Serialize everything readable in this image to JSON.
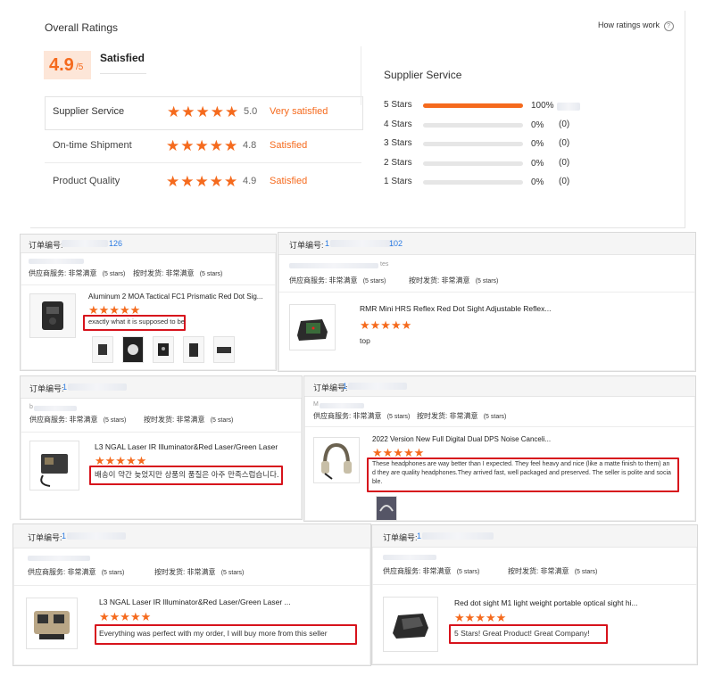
{
  "overall": {
    "title": "Overall Ratings",
    "help_link": "How ratings work",
    "score": "4.9",
    "score_suffix": "/5",
    "level": "Satisfied",
    "stars": "★★★★★",
    "rows": [
      {
        "label": "Supplier Service",
        "score": "5.0",
        "desc": "Very satisfied"
      },
      {
        "label": "On-time Shipment",
        "score": "4.8",
        "desc": "Satisfied"
      },
      {
        "label": "Product Quality",
        "score": "4.9",
        "desc": "Satisfied"
      }
    ]
  },
  "supplier_service": {
    "title": "Supplier Service",
    "bars": [
      {
        "label": "5 Stars",
        "percent": "100%",
        "count": "",
        "fill": 1.0
      },
      {
        "label": "4 Stars",
        "percent": "0%",
        "count": "(0)",
        "fill": 0
      },
      {
        "label": "3 Stars",
        "percent": "0%",
        "count": "(0)",
        "fill": 0
      },
      {
        "label": "2 Stars",
        "percent": "0%",
        "count": "(0)",
        "fill": 0
      },
      {
        "label": "1 Stars",
        "percent": "0%",
        "count": "(0)",
        "fill": 0
      }
    ]
  },
  "reviews": [
    {
      "order_label": "订单编号:",
      "order_suffix": "126",
      "supplier_label": "供应商服务:",
      "supplier_value": "非常满意",
      "supplier_stars": "(5 stars)",
      "ship_label": "按时发货:",
      "ship_value": "非常满意",
      "ship_stars": "(5 stars)",
      "product": "Aluminum 2 MOA Tactical FC1 Prismatic Red Dot Sig...",
      "stars": "★★★★★",
      "comment": "exactly what it is supposed to be"
    },
    {
      "order_label": "订单编号:",
      "order_prefix": "1",
      "order_suffix": "102",
      "owner_suffix": "tes",
      "supplier_label": "供应商服务:",
      "supplier_value": "非常满意",
      "supplier_stars": "(5 stars)",
      "ship_label": "按时发货:",
      "ship_value": "非常满意",
      "ship_stars": "(5 stars)",
      "product": "RMR Mini HRS Reflex Red Dot Sight Adjustable Reflex...",
      "stars": "★★★★★",
      "comment": "top"
    },
    {
      "order_label": "订单编号:",
      "order_prefix": "1",
      "owner_prefix": "b",
      "supplier_label": "供应商服务:",
      "supplier_value": "非常满意",
      "supplier_stars": "(5 stars)",
      "ship_label": "按时发货:",
      "ship_value": "非常满意",
      "ship_stars": "(5 stars)",
      "product": "L3 NGAL Laser IR Illuminator&Red Laser/Green Laser",
      "stars": "★★★★★",
      "comment": "배송이 약간 늦었지만 상품의 품질은 아주 만족스럽습니다."
    },
    {
      "order_label": "订单编号:",
      "order_prefix": "1",
      "owner_prefix": "M",
      "supplier_label": "供应商服务:",
      "supplier_value": "非常满意",
      "supplier_stars": "(5 stars)",
      "ship_label": "按时发货:",
      "ship_value": "非常满意",
      "ship_stars": "(5 stars)",
      "product": "2022 Version New Full Digital Dual DPS Noise Canceli...",
      "stars": "★★★★★",
      "comment_line1": "These headphones are way better than I expected. They feel heavy and nice (like a matte finish to them) an",
      "comment_line2": "d they are quality headphones.They arrived fast, well packaged and preserved. The seller is polite and socia",
      "comment_line3": "ble."
    },
    {
      "order_label": "订单编号:",
      "order_prefix": "1",
      "supplier_label": "供应商服务:",
      "supplier_value": "非常满意",
      "supplier_stars": "(5 stars)",
      "ship_label": "按时发货:",
      "ship_value": "非常满意",
      "ship_stars": "(5 stars)",
      "product": "L3 NGAL Laser IR Illuminator&Red Laser/Green Laser ...",
      "stars": "★★★★★",
      "comment": "Everything was perfect with my order, I will buy more from this seller"
    },
    {
      "order_label": "订单编号:",
      "order_prefix": "1",
      "supplier_label": "供应商服务:",
      "supplier_value": "非常满意",
      "supplier_stars": "(5 stars)",
      "ship_label": "按时发货:",
      "ship_value": "非常满意",
      "ship_stars": "(5 stars)",
      "product": "Red dot sight M1 light weight portable optical sight hi...",
      "stars": "★★★★★",
      "comment": "5 Stars! Great Product! Great Company!"
    }
  ],
  "colors": {
    "accent": "#f56a1d",
    "highlight": "#d7131c",
    "link": "#2a7ae2"
  }
}
